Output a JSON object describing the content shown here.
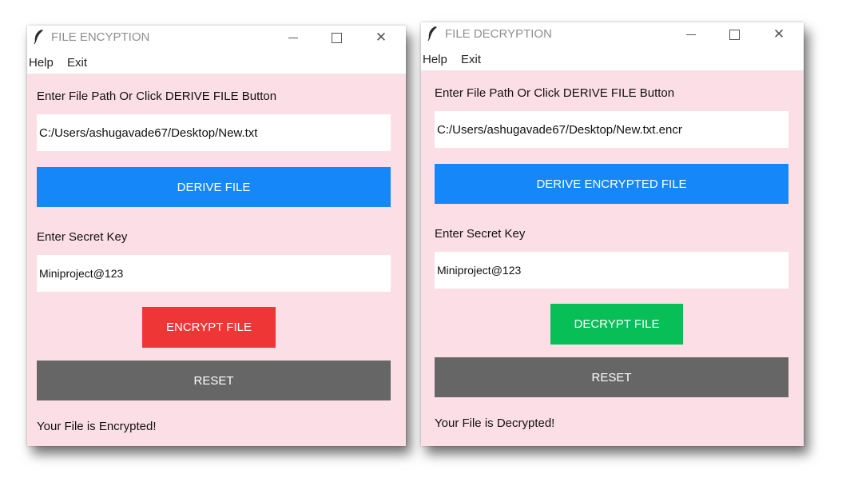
{
  "windows": {
    "encryption": {
      "title": "FILE ENCYPTION",
      "menu": {
        "help": "Help",
        "exit": "Exit"
      },
      "path_label": "Enter File Path Or Click DERIVE FILE Button",
      "path_value": "C:/Users/ashugavade67/Desktop/New.txt",
      "derive_label": "DERIVE FILE",
      "key_label": "Enter Secret Key",
      "key_value": "Miniproject@123",
      "action_label": "ENCRYPT FILE",
      "reset_label": "RESET",
      "status": "Your File is Encrypted!"
    },
    "decryption": {
      "title": "FILE DECRYPTION",
      "menu": {
        "help": "Help",
        "exit": "Exit"
      },
      "path_label": "Enter File Path Or Click DERIVE FILE Button",
      "path_value": "C:/Users/ashugavade67/Desktop/New.txt.encr",
      "derive_label": "DERIVE ENCRYPTED FILE",
      "key_label": "Enter Secret Key",
      "key_value": "Miniproject@123",
      "action_label": "DECRYPT FILE",
      "reset_label": "RESET",
      "status": "Your File is Decrypted!"
    }
  },
  "icons": {
    "app": "feather-icon",
    "minimize": "minimize-icon",
    "maximize": "maximize-icon",
    "close": "close-icon"
  },
  "colors": {
    "window_bg": "#fcdfe6",
    "derive_button": "#1687f8",
    "encrypt_button": "#ee3636",
    "decrypt_button": "#07bf56",
    "reset_button": "#666666"
  }
}
